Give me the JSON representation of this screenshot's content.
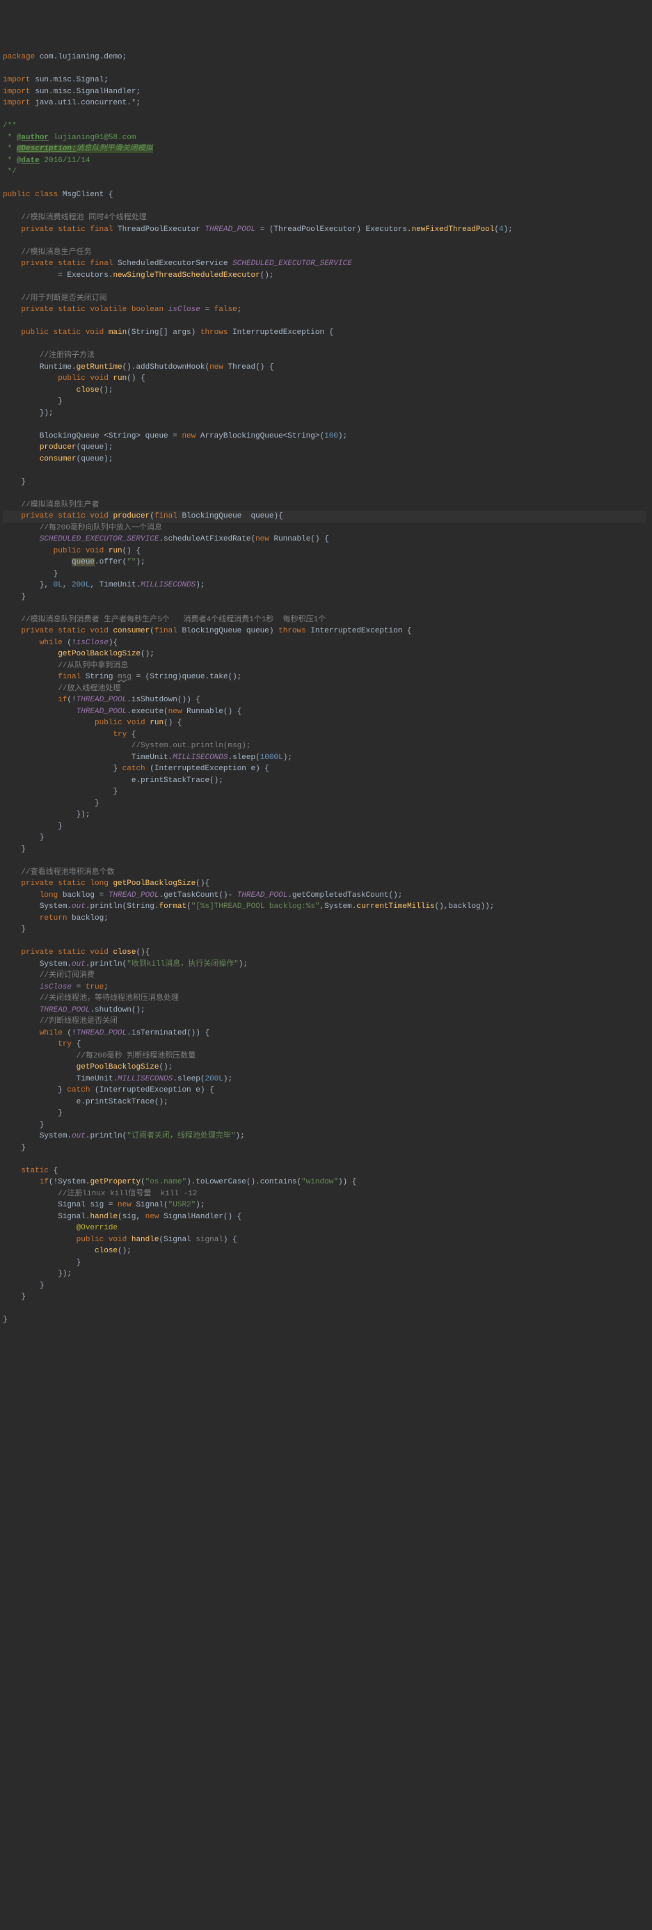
{
  "pkg": {
    "kw": "package",
    "name": "com.lujianing.demo"
  },
  "imports": [
    {
      "kw": "import",
      "name": "sun.misc.Signal"
    },
    {
      "kw": "import",
      "name": "sun.misc.SignalHandler"
    },
    {
      "kw": "import",
      "name": "java.util.concurrent.*"
    }
  ],
  "jd": {
    "open": "/**",
    "author_tag": "@author",
    "author": " lujianing01@58.com",
    "desc_tag": "@Description:",
    "desc": "消息队列平滑关闭模拟",
    "date_tag": "@date",
    "date": " 2016/11/14",
    "close": " */"
  },
  "cls": {
    "mods": "public class ",
    "name": "MsgClient",
    "open": " {"
  },
  "f1": {
    "c": "//模拟消费线程池 同时4个线程处理",
    "mods": "private static final ",
    "type": "ThreadPoolExecutor ",
    "name": "THREAD_POOL",
    "eq": " = (ThreadPoolExecutor) Executors.",
    "call": "newFixedThreadPool",
    "args": "(",
    "n": "4",
    "close": ");"
  },
  "f2": {
    "c": "//模拟消息生产任务",
    "mods": "private static final ",
    "type": "ScheduledExecutorService ",
    "name": "SCHEDULED_EXECUTOR_SERVICE",
    "l2a": "= Executors.",
    "l2b": "newSingleThreadScheduledExecutor",
    "l2c": "();"
  },
  "f3": {
    "c": "//用于判断是否关闭订阅",
    "mods": "private static volatile boolean ",
    "name": "isClose",
    "eq": " = ",
    "v": "false",
    "sc": ";"
  },
  "main": {
    "sig_a": "public static void ",
    "sig_b": "main",
    "sig_c": "(String[] args) ",
    "sig_d": "throws ",
    "sig_e": "InterruptedException {",
    "c1": "//注册钩子方法",
    "l1": "Runtime.",
    "l1b": "getRuntime",
    "l1c": "().addShutdownHook(",
    "l1d": "new ",
    "l1e": "Thread() {",
    "run_a": "public void ",
    "run_b": "run",
    "run_c": "() {",
    "close_call": "close",
    "close_args": "();",
    "cb1": "}",
    "cb2": "});",
    "q1a": "BlockingQueue <String> queue = ",
    "q1b": "new ",
    "q1c": "ArrayBlockingQueue<String>(",
    "q1d": "100",
    "q1e": ");",
    "p": "producer",
    "pa": "(queue);",
    "cn": "consumer",
    "cna": "(queue);",
    "cb": "}"
  },
  "prod": {
    "c": "//模拟消息队列生产者",
    "sig_a": "private static void ",
    "sig_b": "producer",
    "sig_c": "(",
    "sig_d": "final ",
    "sig_e": "BlockingQueue  queue){",
    "c1": "//每200毫秒向队列中放入一个消息",
    "s1": "SCHEDULED_EXECUTOR_SERVICE",
    "s2": ".scheduleAtFixedRate(",
    "s3": "new ",
    "s4": "Runnable() {",
    "run_a": "public void ",
    "run_b": "run",
    "run_c": "() {",
    "off1": "queue",
    "off2": ".offer(",
    "off3": "\"\"",
    "off4": ");",
    "cb1": "}",
    "end1": "}, ",
    "n1": "0L",
    "end2": ", ",
    "n2": "200L",
    "end3": ", TimeUnit.",
    "en": "MILLISECONDS",
    "end4": ");",
    "cb": "}"
  },
  "cons": {
    "c": "//模拟消息队列消费者 生产者每秒生产5个   消费者4个线程消费1个1秒  每秒积压1个",
    "sig_a": "private static void ",
    "sig_b": "consumer",
    "sig_c": "(",
    "sig_d": "final ",
    "sig_e": "BlockingQueue queue) ",
    "sig_f": "throws ",
    "sig_g": "InterruptedException {",
    "w1": "while ",
    "w2": "(!",
    "w3": "isClose",
    "w4": "){",
    "g1": "getPoolBacklogSize",
    "g2": "();",
    "c1": "//从队列中拿到消息",
    "t1": "final ",
    "t2": "String ",
    "t3": "msg",
    "t4": " = (String)queue.take();",
    "c2": "//放入线程池处理",
    "i1": "if",
    "i2": "(!",
    "i3": "THREAD_POOL",
    "i4": ".isShutdown()) {",
    "e1": "THREAD_POOL",
    "e2": ".execute(",
    "e3": "new ",
    "e4": "Runnable() {",
    "run_a": "public void ",
    "run_b": "run",
    "run_c": "() {",
    "tr": "try ",
    "tro": "{",
    "cc": "//System.out.println(msg);",
    "sl1": "TimeUnit.",
    "sl2": "MILLISECONDS",
    "sl3": ".sleep(",
    "sl4": "1000L",
    "sl5": ");",
    "ca1": "} ",
    "ca2": "catch ",
    "ca3": "(InterruptedException e) {",
    "pst": "e.printStackTrace();",
    "cb1": "}",
    "cb2": "}",
    "cb3": "});",
    "cb4": "}",
    "cb5": "}",
    "cb6": "}"
  },
  "gbs": {
    "c": "//查看线程池堆积消息个数",
    "sig_a": "private static long ",
    "sig_b": "getPoolBacklogSize",
    "sig_c": "(){",
    "l1a": "long ",
    "l1b": "backlog = ",
    "l1c": "THREAD_POOL",
    "l1d": ".getTaskCount()- ",
    "l1e": "THREAD_POOL",
    "l1f": ".getCompletedTaskCount();",
    "p1": "System.",
    "p2": "out",
    "p3": ".println(String.",
    "p4": "format",
    "p5": "(",
    "p6": "\"[%s]THREAD_POOL backlog:%s\"",
    "p7": ",System.",
    "p8": "currentTimeMillis",
    "p9": "(),backlog));",
    "r1": "return ",
    "r2": "backlog;",
    "cb": "}"
  },
  "close": {
    "sig_a": "private static void ",
    "sig_b": "close",
    "sig_c": "(){",
    "p1": "System.",
    "p2": "out",
    "p3": ".println(",
    "p4": "\"收到kill消息，执行关闭操作\"",
    "p5": ");",
    "c1": "//关闭订阅消费",
    "a1": "isClose ",
    "a2": "= ",
    "a3": "true",
    "a4": ";",
    "c2": "//关闭线程池，等待线程池积压消息处理",
    "s1": "THREAD_POOL",
    "s2": ".shutdown();",
    "c3": "//判断线程池是否关闭",
    "w1": "while ",
    "w2": "(!",
    "w3": "THREAD_POOL",
    "w4": ".isTerminated()) {",
    "tr": "try ",
    "tro": "{",
    "c4": "//每200毫秒 判断线程池积压数量",
    "g1": "getPoolBacklogSize",
    "g2": "();",
    "sl1": "TimeUnit.",
    "sl2": "MILLISECONDS",
    "sl3": ".sleep(",
    "sl4": "200L",
    "sl5": ");",
    "ca1": "} ",
    "ca2": "catch ",
    "ca3": "(InterruptedException e) {",
    "pst": "e.printStackTrace();",
    "cb1": "}",
    "cb2": "}",
    "pe1": "System.",
    "pe2": "out",
    "pe3": ".println(",
    "pe4": "\"订阅者关闭，线程池处理完毕\"",
    "pe5": ");",
    "cb": "}"
  },
  "stat": {
    "sig": "static ",
    "open": "{",
    "i1": "if",
    "i2": "(!System.",
    "i3": "getProperty",
    "i4": "(",
    "i5": "\"os.name\"",
    "i6": ").toLowerCase().contains(",
    "i7": "\"window\"",
    "i8": ")) {",
    "c1": "//注册linux kill信号量  kill -12",
    "s1": "Signal sig = ",
    "s2": "new ",
    "s3": "Signal(",
    "s4": "\"USR2\"",
    "s5": ");",
    "h1": "Signal.",
    "h2": "handle",
    "h3": "(sig, ",
    "h4": "new ",
    "h5": "SignalHandler() {",
    "ov": "@Override",
    "ha": "public void ",
    "hb": "handle",
    "hc": "(Signal ",
    "hd": "signal",
    "he": ") {",
    "cl1": "close",
    "cl2": "();",
    "cb1": "}",
    "cb2": "});",
    "cb3": "}",
    "cb4": "}",
    "final": "}"
  }
}
